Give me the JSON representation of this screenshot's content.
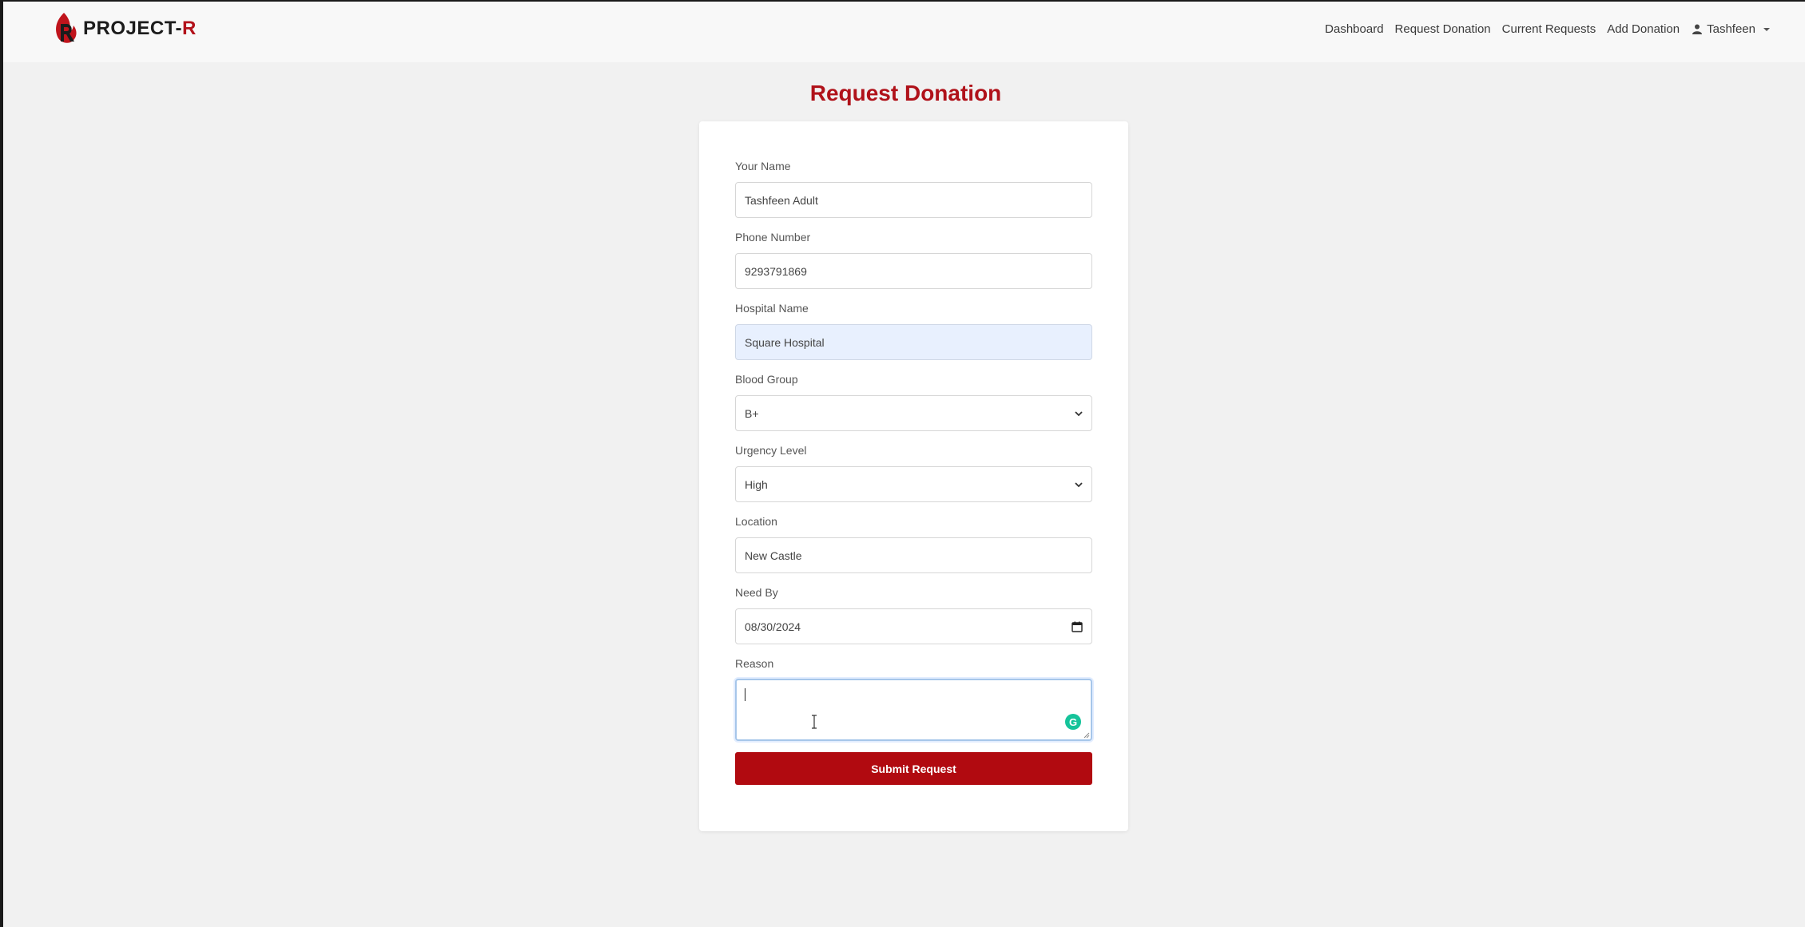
{
  "brand": {
    "name_prefix": "PROJECT-",
    "name_suffix": "R",
    "logo_icon": "flame-r-logo-icon",
    "accent_color": "#b3121b"
  },
  "nav": {
    "items": [
      {
        "label": "Dashboard"
      },
      {
        "label": "Request Donation"
      },
      {
        "label": "Current Requests"
      },
      {
        "label": "Add Donation"
      }
    ],
    "user": {
      "name": "Tashfeen",
      "icon": "user-icon"
    }
  },
  "page": {
    "title": "Request Donation",
    "title_color": "#b0121a"
  },
  "form": {
    "name": {
      "label": "Your Name",
      "value": "Tashfeen Adult"
    },
    "phone": {
      "label": "Phone Number",
      "value": "9293791869"
    },
    "hospital": {
      "label": "Hospital Name",
      "value": "Square Hospital"
    },
    "blood_group": {
      "label": "Blood Group",
      "value": "B+"
    },
    "urgency": {
      "label": "Urgency Level",
      "value": "High"
    },
    "location": {
      "label": "Location",
      "value": "New Castle"
    },
    "need_by": {
      "label": "Need By",
      "value": "08/30/2024"
    },
    "reason": {
      "label": "Reason",
      "value": ""
    },
    "submit_label": "Submit Request",
    "submit_color": "#b10a10"
  }
}
